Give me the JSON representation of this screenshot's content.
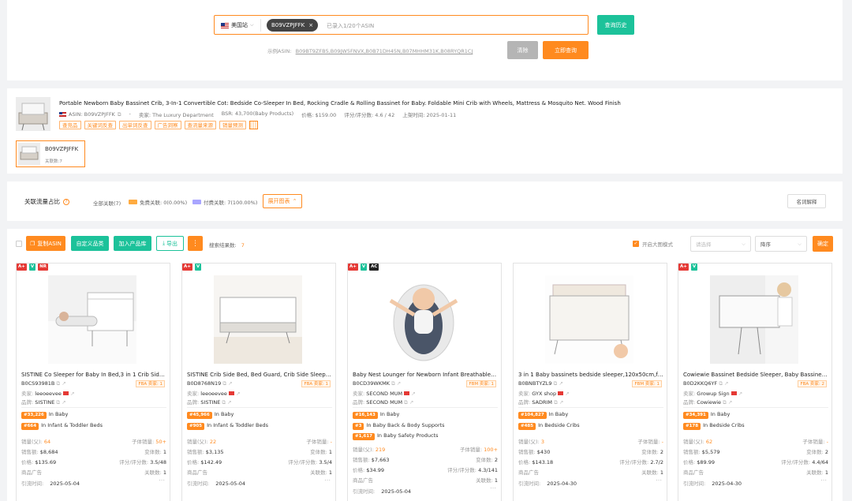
{
  "search": {
    "site_label": "美国站",
    "asin_chip": "B09VZPJFFK",
    "placeholder": "已录入1/20个ASIN",
    "history_button": "查询历史",
    "example_label": "示例ASIN:",
    "example_asins": "B09BT9ZFB5,B09JW5FNVX,B0B71DH45N,B07MHHM31K,B08RYQR1CJ",
    "clear_button": "清除",
    "query_button": "立即查询"
  },
  "product": {
    "title": "Portable Newborn Baby Bassinet Crib, 3-In-1 Convertible Cot: Bedside Co-Sleeper In Bed, Rocking Cradle & Rolling Bassinet for Baby. Foldable Mini Crib with Wheels, Mattress & Mosquito Net. Wood Finish",
    "asin": "ASIN: B09VZPJFFK",
    "seller": "卖家: The Luxury Department",
    "bsr": "BSR: 43,700(Baby Products)",
    "price": "价格: $159.00",
    "rating": "评分/评分数: 4.6 / 42",
    "listed": "上架时间: 2025-01-11",
    "tags": [
      "查竞品",
      "关键词反查",
      "出单词反查",
      "广告洞察",
      "查流量来源",
      "销量预测"
    ],
    "variant_asin": "B09VZPJFFK",
    "variant_count": "关联数:7"
  },
  "traffic": {
    "label": "关联流量占比",
    "all": "全部关联(7)",
    "free": "免费关联: 0(0.00%)",
    "paid": "付费关联: 7(100.00%)",
    "expand": "展开图表",
    "glossary": "名词解释"
  },
  "toolbar": {
    "copy_asin": "复制ASIN",
    "custom_category": "自定义品类",
    "add_to_library": "加入产品库",
    "export": "导出",
    "more": "⋮",
    "results_label": "搜索结果数:",
    "results_count": "7",
    "big_image_mode": "开启大图模式",
    "select_placeholder": "请选择",
    "sort_placeholder": "降序",
    "confirm": "确定"
  },
  "labels": {
    "seller": "卖家:",
    "brand": "品牌:",
    "monthly_sales": "销量(父):",
    "sub_sales": "子体销量:",
    "revenue": "销售额:",
    "variants": "变体数:",
    "price": "价格:",
    "rating": "评分/评分数:",
    "ads": "商品广告",
    "links": "关联数:",
    "crawl_time": "引流时间:"
  },
  "cards": [
    {
      "badges": [
        "A+",
        "V",
        "NR"
      ],
      "title": "SISTINE Co Sleeper for Baby In Bed,3 in 1 Crib Side Sleeper...",
      "asin": "B0CS93981B",
      "fulfill": "FBA",
      "sellers_count": "卖家: 1",
      "seller": "leeoeevee",
      "brand": "SISTINE",
      "ranks": [
        {
          "rank": "#33,226",
          "cat": "In Baby"
        },
        {
          "rank": "#664",
          "cat": "In Infant & Toddler Beds"
        }
      ],
      "sales": "64",
      "sub_sales": "50+",
      "revenue": "$8,684",
      "variants": "1",
      "price": "$135.69",
      "rating": "3.5/48",
      "links": "1",
      "time": "2025-05-04"
    },
    {
      "badges": [
        "A+",
        "V"
      ],
      "title": "SISTINE Crib Side Bed, Bed Guard, Crib Side Sleeper for Baby...",
      "asin": "B0D8768N19",
      "fulfill": "FBA",
      "sellers_count": "卖家: 1",
      "seller": "leeoeevee",
      "brand": "SISTINE",
      "ranks": [
        {
          "rank": "#45,966",
          "cat": "In Baby"
        },
        {
          "rank": "#905",
          "cat": "In Infant & Toddler Beds"
        }
      ],
      "sales": "22",
      "sub_sales": "-",
      "revenue": "$3,135",
      "variants": "1",
      "price": "$142.49",
      "rating": "3.5/4",
      "links": "1",
      "time": "2025-05-04"
    },
    {
      "badges": [
        "A+",
        "V",
        "AC"
      ],
      "title": "Baby Nest Lounger for Newborn Infant Breathable Portable...",
      "asin": "B0CD39WKMK",
      "fulfill": "FBM",
      "sellers_count": "卖家: 1",
      "seller": "SECOND MUM",
      "brand": "SECOND MUM",
      "ranks": [
        {
          "rank": "#16,143",
          "cat": "In Baby"
        },
        {
          "rank": "#3",
          "cat": "In Baby Back & Body Supports"
        },
        {
          "rank": "#1,617",
          "cat": "In Baby Safety Products"
        }
      ],
      "sales": "219",
      "sub_sales": "100+",
      "revenue": "$7,663",
      "variants": "2",
      "price": "$34.99",
      "rating": "4.3/141",
      "links": "1",
      "time": "2025-05-04"
    },
    {
      "badges": [],
      "title": "3 in 1 Baby bassinets bedside sleeper,120x50cm,foldable...",
      "asin": "B0BNBTYZL9",
      "fulfill": "FBM",
      "sellers_count": "卖家: 1",
      "seller": "GYX shop",
      "brand": "SADRIM",
      "ranks": [
        {
          "rank": "#104,827",
          "cat": "In Baby"
        },
        {
          "rank": "#485",
          "cat": "In Bedside Cribs"
        }
      ],
      "sales": "3",
      "sub_sales": "-",
      "revenue": "$430",
      "variants": "2",
      "price": "$143.18",
      "rating": "2.7/2",
      "links": "1",
      "time": "2025-04-30"
    },
    {
      "badges": [
        "A+",
        "V"
      ],
      "title": "Cowiewie Bassinet Bedside Sleeper, Baby Bassinet with Wheels...",
      "asin": "B0D2KKQ6YF",
      "fulfill": "FBA",
      "sellers_count": "卖家: 2",
      "seller": "Growup Sign",
      "brand": "Cowiewie",
      "ranks": [
        {
          "rank": "#34,391",
          "cat": "In Baby"
        },
        {
          "rank": "#178",
          "cat": "In Bedside Cribs"
        }
      ],
      "sales": "62",
      "sub_sales": "-",
      "revenue": "$5,579",
      "variants": "2",
      "price": "$89.99",
      "rating": "4.4/64",
      "links": "1",
      "time": "2025-04-30"
    }
  ]
}
